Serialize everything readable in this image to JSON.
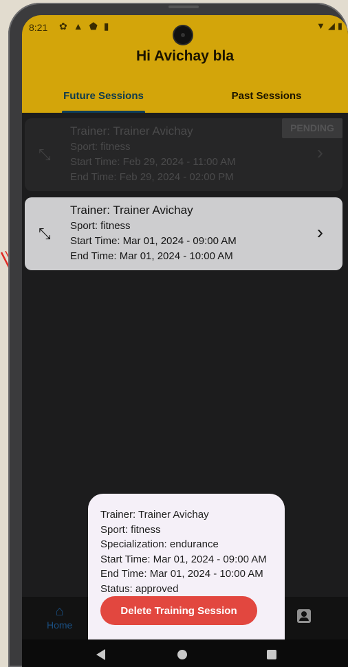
{
  "status_bar": {
    "time": "8:21",
    "left_icons": [
      "settings-icon",
      "warning-icon",
      "shield-icon",
      "sd-card-icon"
    ],
    "right_icons": [
      "wifi-icon",
      "signal-icon",
      "battery-icon"
    ]
  },
  "header": {
    "greeting": "Hi Avichay bla",
    "background_color": "#d3a50a"
  },
  "tabs": [
    {
      "label": "Future Sessions",
      "active": true
    },
    {
      "label": "Past Sessions",
      "active": false
    }
  ],
  "sessions": [
    {
      "trainer": "Trainer: Trainer Avichay",
      "sport": "Sport: fitness",
      "start": "Start Time: Feb 29, 2024 - 11:00 AM",
      "end": "End Time: Feb 29, 2024 - 02:00 PM",
      "badge": "PENDING",
      "icon": "dumbbell-icon"
    },
    {
      "trainer": "Trainer: Trainer Avichay",
      "sport": "Sport: fitness",
      "start": "Start Time: Mar 01, 2024 - 09:00 AM",
      "end": "End Time: Mar 01, 2024 - 10:00 AM",
      "icon": "dumbbell-icon"
    }
  ],
  "popup": {
    "trainer": "Trainer: Trainer Avichay",
    "sport": "Sport: fitness",
    "specialization": "Specialization: endurance",
    "start": "Start Time: Mar 01, 2024 - 09:00 AM",
    "end": "End Time: Mar 01, 2024 - 10:00 AM",
    "status": "Status: approved",
    "delete_label": "Delete Training Session",
    "delete_color": "#e2473f"
  },
  "bottom_nav": {
    "home_label": "Home",
    "home_icon": "home-icon",
    "profile_icon": "profile-icon"
  }
}
